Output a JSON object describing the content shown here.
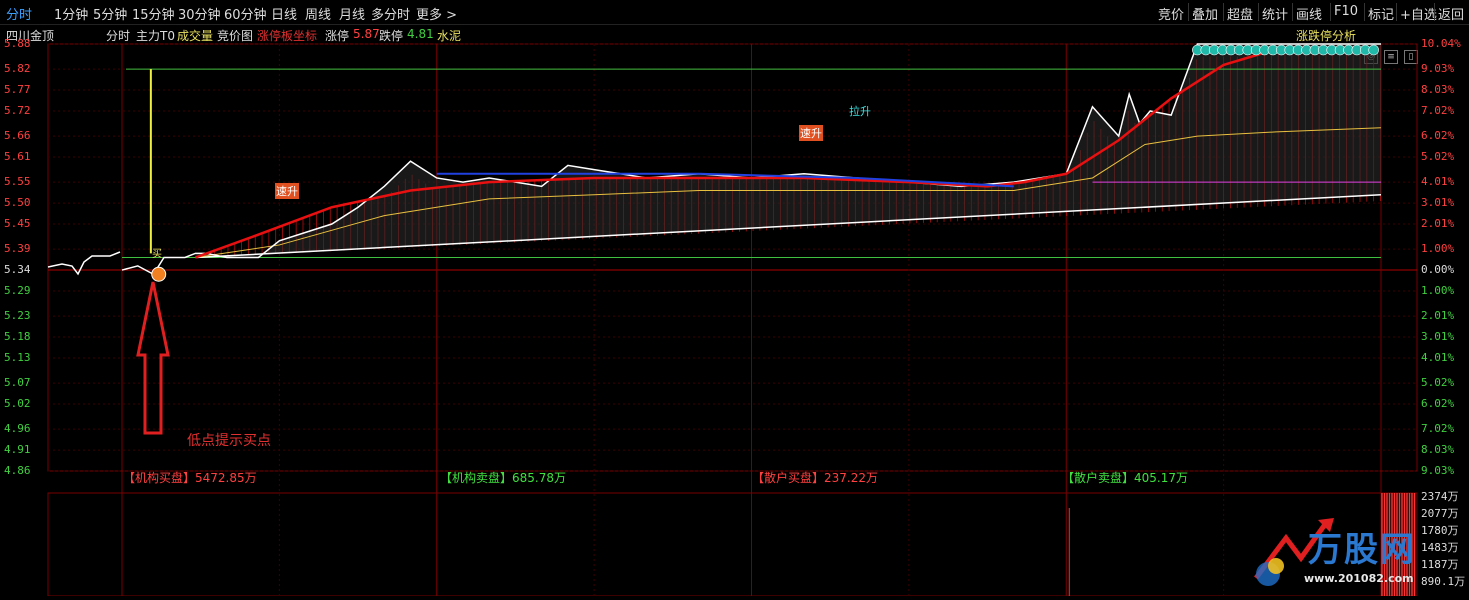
{
  "toolbar": {
    "left": [
      "分时",
      "1分钟",
      "5分钟",
      "15分钟",
      "30分钟",
      "60分钟",
      "日线",
      "周线",
      "月线",
      "多分时",
      "更多 >"
    ],
    "right": [
      "竞价",
      "叠加",
      "超盘",
      "统计",
      "画线",
      "F10",
      "标记",
      "+自选",
      "返回"
    ]
  },
  "info": {
    "name": "四川金顶",
    "mode": "分时",
    "indicator": "主力T0",
    "volume": "成交量",
    "auction": "竞价图",
    "limit_coord": "涨停板坐标",
    "up_label": "涨停",
    "up_value": "5.87",
    "down_label": "跌停",
    "down_value": "4.81",
    "sector": "水泥",
    "analysis": "涨跌停分析"
  },
  "flows": {
    "inst_buy": "【机构买盘】5472.85万",
    "inst_sell": "【机构卖盘】685.78万",
    "retail_buy": "【散户买盘】237.22万",
    "retail_sell": "【散户卖盘】405.17万"
  },
  "annotations": {
    "buy_hint": "低点提示买点",
    "surge1": "速升",
    "surge2": "速升",
    "pull_up": "拉升",
    "buy_mark": "买"
  },
  "volume_axis": [
    "2374万",
    "2077万",
    "1780万",
    "1483万",
    "1187万",
    "890.1万"
  ],
  "watermark": {
    "text": "万股网",
    "url": "www.201082.com"
  },
  "colors": {
    "up": "#ff3030",
    "down": "#30c030",
    "price": "#ffffff",
    "avg": "#e8c040",
    "main_force": "#e81010",
    "grid": "#7a0000"
  },
  "chart_data": {
    "type": "line",
    "prev_close": 5.34,
    "y_price_ticks": [
      "5.88",
      "5.82",
      "5.77",
      "5.72",
      "5.66",
      "5.61",
      "5.55",
      "5.50",
      "5.45",
      "5.39",
      "5.34",
      "5.29",
      "5.23",
      "5.18",
      "5.13",
      "5.07",
      "5.02",
      "4.96",
      "4.91",
      "4.86"
    ],
    "y_pct_ticks": [
      "10.04%",
      "9.03%",
      "8.03%",
      "7.02%",
      "6.02%",
      "5.02%",
      "4.01%",
      "3.01%",
      "2.01%",
      "1.00%",
      "0.00%",
      "1.00%",
      "2.01%",
      "3.01%",
      "4.01%",
      "5.02%",
      "6.02%",
      "7.02%",
      "8.03%",
      "9.03%"
    ],
    "ylim": [
      4.86,
      5.88
    ],
    "x_minutes": [
      240
    ],
    "series": [
      {
        "values_x": [
          0,
          3,
          6,
          8,
          10,
          12,
          14,
          16,
          20,
          26,
          30,
          35,
          40,
          45,
          50,
          55,
          60,
          65,
          70,
          75,
          80,
          85,
          90,
          95,
          100,
          110,
          120,
          130,
          140,
          150,
          160,
          170,
          180,
          185,
          190,
          192,
          194,
          196,
          200,
          205,
          210,
          215,
          220,
          240
        ],
        "values_y": [
          5.34,
          5.35,
          5.33,
          5.37,
          5.37,
          5.37,
          5.38,
          5.38,
          5.37,
          5.37,
          5.41,
          5.43,
          5.45,
          5.49,
          5.54,
          5.6,
          5.56,
          5.55,
          5.56,
          5.55,
          5.54,
          5.59,
          5.58,
          5.57,
          5.56,
          5.57,
          5.56,
          5.57,
          5.56,
          5.55,
          5.54,
          5.55,
          5.57,
          5.73,
          5.66,
          5.76,
          5.69,
          5.72,
          5.71,
          5.88,
          5.88,
          5.88,
          5.88,
          5.88
        ]
      },
      {
        "values_x": [
          14,
          30,
          50,
          70,
          90,
          110,
          130,
          150,
          170,
          185,
          195,
          205,
          220,
          240
        ],
        "values_y": [
          5.37,
          5.4,
          5.47,
          5.51,
          5.52,
          5.53,
          5.53,
          5.53,
          5.53,
          5.56,
          5.64,
          5.66,
          5.67,
          5.68
        ]
      },
      {
        "values_x": [
          14,
          25,
          40,
          55,
          70,
          90,
          110,
          130,
          150,
          165,
          172,
          180,
          190,
          200,
          210,
          218
        ],
        "values_y": [
          5.37,
          5.42,
          5.49,
          5.53,
          5.55,
          5.56,
          5.56,
          5.56,
          5.55,
          5.54,
          5.55,
          5.57,
          5.65,
          5.75,
          5.83,
          5.86
        ]
      }
    ],
    "reference_lines": [
      5.82,
      5.55,
      5.37
    ],
    "volume_peak_minute": 180
  }
}
